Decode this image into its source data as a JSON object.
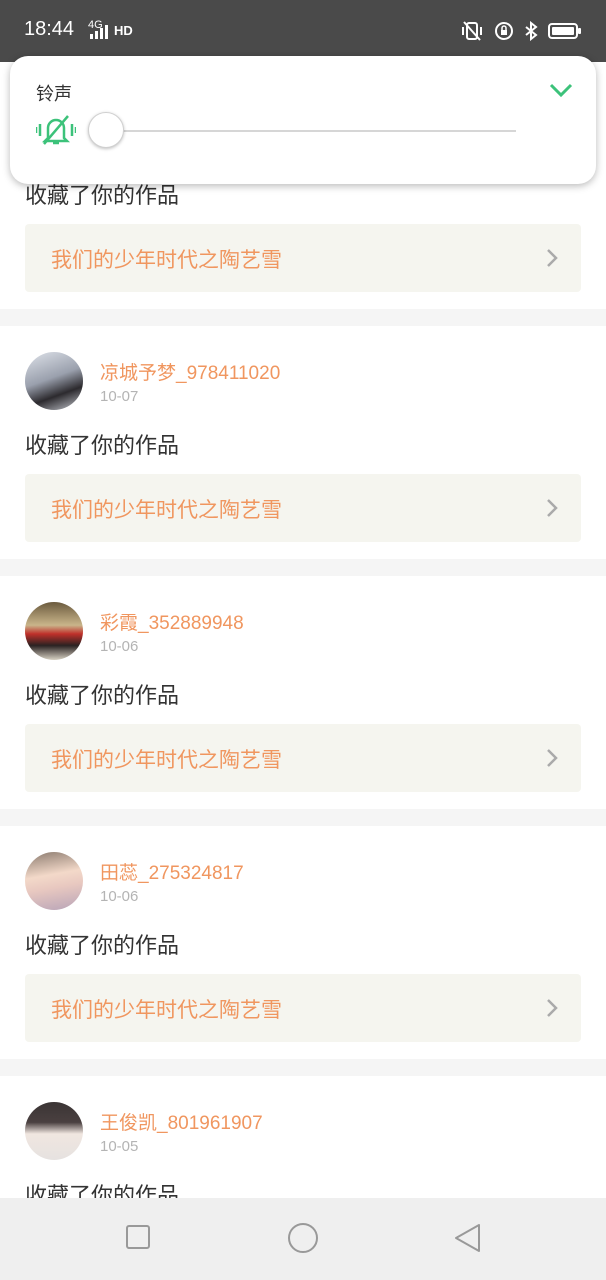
{
  "status_bar": {
    "time": "18:44",
    "network": "4G",
    "hd": "HD"
  },
  "ringtone_panel": {
    "label": "铃声",
    "volume_level": 0
  },
  "feed": {
    "first_partial": {
      "action": "收藏了你的作品",
      "work_title": "我们的少年时代之陶艺雪"
    },
    "items": [
      {
        "username": "凉城予梦_978411020",
        "date": "10-07",
        "action": "收藏了你的作品",
        "work_title": "我们的少年时代之陶艺雪"
      },
      {
        "username": "彩霞_352889948",
        "date": "10-06",
        "action": "收藏了你的作品",
        "work_title": "我们的少年时代之陶艺雪"
      },
      {
        "username": "田蕊_275324817",
        "date": "10-06",
        "action": "收藏了你的作品",
        "work_title": "我们的少年时代之陶艺雪"
      },
      {
        "username": "王俊凯_801961907",
        "date": "10-05",
        "action": "收藏了你的作品"
      }
    ]
  },
  "colors": {
    "accent_green": "#3cc27a",
    "username_orange": "#f0965f",
    "status_bar_bg": "#4a4a4a"
  }
}
